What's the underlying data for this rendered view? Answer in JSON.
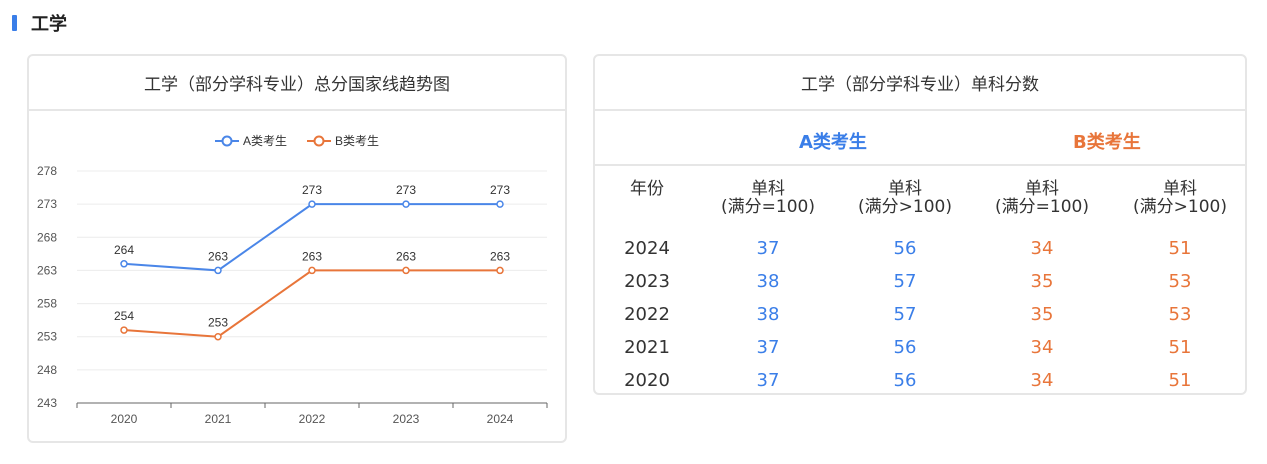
{
  "section": {
    "title": "工学"
  },
  "chart": {
    "title": "工学（部分学科专业）总分国家线趋势图"
  },
  "chart_data": {
    "type": "line",
    "title": "工学（部分学科专业）总分国家线趋势图",
    "categories": [
      "2020",
      "2021",
      "2022",
      "2023",
      "2024"
    ],
    "series": [
      {
        "name": "A类考生",
        "values": [
          264,
          263,
          273,
          273,
          273
        ],
        "color": "#4a86e8"
      },
      {
        "name": "B类考生",
        "values": [
          254,
          253,
          263,
          263,
          263
        ],
        "color": "#e8753a"
      }
    ],
    "yticks": [
      243,
      248,
      253,
      258,
      263,
      268,
      273,
      278
    ],
    "ylim": [
      243,
      278
    ],
    "grid": true,
    "legend": "top-center",
    "data_labels": true
  },
  "table": {
    "title": "工学（部分学科专业）单科分数",
    "group_a": "A类考生",
    "group_b": "B类考生",
    "col_year": "年份",
    "col_single_a1": "单科",
    "col_single_a1_sub": "(满分=100)",
    "col_single_a2": "单科",
    "col_single_a2_sub": "(满分>100)",
    "col_single_b1": "单科",
    "col_single_b1_sub": "(满分=100)",
    "col_single_b2": "单科",
    "col_single_b2_sub": "(满分>100)",
    "rows": [
      {
        "year": "2024",
        "a1": "37",
        "a2": "56",
        "b1": "34",
        "b2": "51"
      },
      {
        "year": "2023",
        "a1": "38",
        "a2": "57",
        "b1": "35",
        "b2": "53"
      },
      {
        "year": "2022",
        "a1": "38",
        "a2": "57",
        "b1": "35",
        "b2": "53"
      },
      {
        "year": "2021",
        "a1": "37",
        "a2": "56",
        "b1": "34",
        "b2": "51"
      },
      {
        "year": "2020",
        "a1": "37",
        "a2": "56",
        "b1": "34",
        "b2": "51"
      }
    ]
  }
}
